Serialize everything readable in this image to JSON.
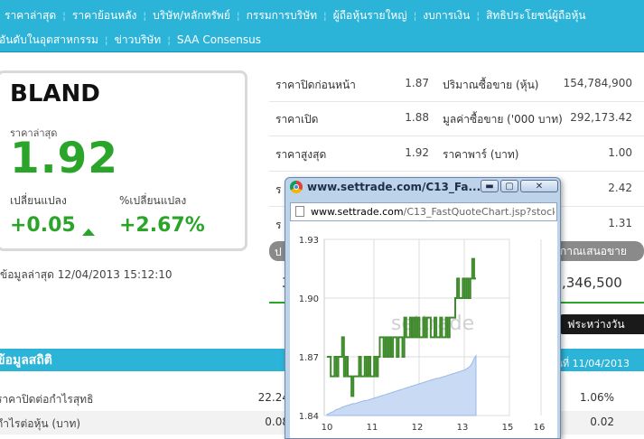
{
  "nav": {
    "row1": [
      "ราคาล่าสุด",
      "ราคาย้อนหลัง",
      "บริษัท/หลักทรัพย์",
      "กรรมการบริษัท",
      "ผู้ถือหุ้นรายใหญ่",
      "งบการเงิน",
      "สิทธิประโยชน์ผู้ถือหุ้น"
    ],
    "row2": [
      "อันดับในอุตสาหกรรม",
      "ข่าวบริษัท",
      "SAA Consensus"
    ]
  },
  "stock": {
    "symbol": "BLAND",
    "last_label": "ราคาล่าสุด",
    "last_price": "1.92",
    "change_label": "เปลี่ยนแปลง",
    "pct_change_label": "%เปลี่ยนแปลง",
    "change": "+0.05",
    "pct_change": "+2.67%",
    "updated": "ข้อมูลล่าสุด 12/04/2013 15:12:10",
    "trend": "up"
  },
  "quote": {
    "left": [
      {
        "label": "ราคาปิดก่อนหน้า",
        "value": "1.87"
      },
      {
        "label": "ราคาเปิด",
        "value": "1.88"
      },
      {
        "label": "ราคาสูงสุด",
        "value": "1.92"
      },
      {
        "label": "ร",
        "value": ""
      },
      {
        "label": "ร",
        "value": ""
      }
    ],
    "right": [
      {
        "label": "ปริมาณซื้อขาย (หุ้น)",
        "value": "154,784,900"
      },
      {
        "label": "มูลค่าซื้อขาย ('000 บาท)",
        "value": "292,173.42"
      },
      {
        "label": "ราคาพาร์ (บาท)",
        "value": "1.00"
      },
      {
        "label": "",
        "value": "2.42"
      },
      {
        "label": "",
        "value": "1.31"
      }
    ]
  },
  "tabs": {
    "left_partial": "ป",
    "right_partial": "กาณเสนอขาย",
    "big_volume": ",346,500",
    "left_num": "3",
    "intraday": "ฟระหว่างวัน"
  },
  "stats": {
    "title": "ข้อมูลสถิติ",
    "date": "ณ วันที่ 11/04/2013",
    "rows": [
      {
        "label": "ราคาปิดต่อกำไรสุทธิ",
        "v1": "22.24",
        "v2": "1.06%"
      },
      {
        "label": "กำไรต่อหุ้น (บาท)",
        "v1": "0.08",
        "v2": "0.02"
      }
    ]
  },
  "popup": {
    "title": "www.settrade.com/C13_Fa...",
    "url_host": "www.settrade.com",
    "url_path": "/C13_FastQuoteChart.jsp?stockSymb",
    "buttons": {
      "minimize": "▬",
      "maximize": "▢",
      "close": "✕"
    }
  },
  "chart_data": {
    "type": "line",
    "watermark": "settrade",
    "x_ticks": [
      "10",
      "11",
      "12",
      "13",
      "15",
      "16"
    ],
    "y_ticks": [
      "1.93",
      "1.90",
      "1.87",
      "1.84"
    ],
    "ylim": [
      1.84,
      1.93
    ],
    "price_x": [
      0,
      1,
      2,
      3,
      4,
      5,
      6,
      7,
      8,
      9,
      10,
      11,
      12,
      13,
      14,
      15,
      16,
      17,
      18,
      19,
      20,
      21,
      22,
      23,
      24,
      25,
      26,
      27,
      28,
      29,
      30,
      31,
      32,
      33,
      34,
      35,
      36,
      37,
      38,
      39,
      40,
      41,
      42,
      43,
      44,
      45,
      46,
      47,
      48,
      49,
      50,
      51,
      52,
      53,
      54,
      55,
      56,
      57,
      58,
      59,
      60,
      61,
      62,
      63,
      64,
      65,
      66,
      67,
      68,
      69,
      70,
      71,
      72,
      73,
      74,
      75,
      76,
      77,
      78,
      79
    ],
    "price": [
      1.87,
      1.87,
      1.86,
      1.86,
      1.87,
      1.86,
      1.87,
      1.87,
      1.88,
      1.86,
      1.87,
      1.86,
      1.86,
      1.85,
      1.86,
      1.86,
      1.86,
      1.87,
      1.86,
      1.86,
      1.87,
      1.86,
      1.87,
      1.86,
      1.86,
      1.87,
      1.86,
      1.87,
      1.88,
      1.88,
      1.87,
      1.88,
      1.87,
      1.88,
      1.87,
      1.88,
      1.88,
      1.87,
      1.88,
      1.88,
      1.87,
      1.89,
      1.88,
      1.88,
      1.89,
      1.88,
      1.89,
      1.88,
      1.89,
      1.88,
      1.88,
      1.89,
      1.88,
      1.89,
      1.89,
      1.88,
      1.88,
      1.89,
      1.88,
      1.88,
      1.89,
      1.88,
      1.88,
      1.89,
      1.88,
      1.89,
      1.89,
      1.89,
      1.9,
      1.91,
      1.9,
      1.9,
      1.91,
      1.9,
      1.91,
      1.9,
      1.91,
      1.92,
      1.91,
      1.91
    ],
    "volume_curve": [
      0.02,
      0.03,
      0.05,
      0.06,
      0.08,
      0.1,
      0.11,
      0.12,
      0.14,
      0.15,
      0.16,
      0.17,
      0.18,
      0.19,
      0.2,
      0.2,
      0.21,
      0.22,
      0.23,
      0.24,
      0.25,
      0.25,
      0.26,
      0.27,
      0.28,
      0.29,
      0.3,
      0.31,
      0.32,
      0.33,
      0.34,
      0.35,
      0.36,
      0.37,
      0.38,
      0.39,
      0.4,
      0.41,
      0.42,
      0.43,
      0.44,
      0.45,
      0.46,
      0.47,
      0.48,
      0.49,
      0.5,
      0.51,
      0.52,
      0.53,
      0.54,
      0.55,
      0.56,
      0.57,
      0.58,
      0.59,
      0.6,
      0.61,
      0.62,
      0.62,
      0.63,
      0.64,
      0.65,
      0.66,
      0.67,
      0.68,
      0.69,
      0.7,
      0.71,
      0.72,
      0.73,
      0.74,
      0.75,
      0.76,
      0.78,
      0.8,
      0.83,
      0.88,
      0.95,
      1.0
    ],
    "colors": {
      "price": "#3d8a2a",
      "volume": "#c9daf5",
      "grid": "#dddddd"
    }
  }
}
